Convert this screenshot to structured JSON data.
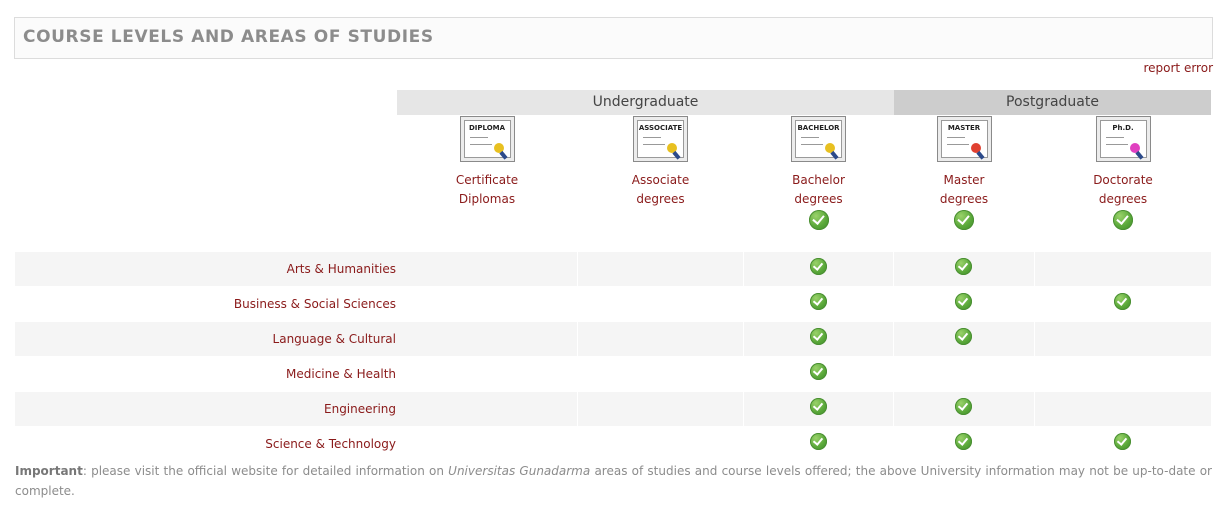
{
  "header": {
    "title": "COURSE LEVELS AND AREAS OF STUDIES"
  },
  "report_error": "report error",
  "groups": {
    "undergraduate": "Undergraduate",
    "postgraduate": "Postgraduate"
  },
  "levels": [
    {
      "cert_label": "DIPLOMA",
      "name_line1": "Certificate",
      "name_line2": "Diplomas",
      "offered": false,
      "seal_color": "#e8c020"
    },
    {
      "cert_label": "ASSOCIATE",
      "name_line1": "Associate",
      "name_line2": "degrees",
      "offered": false,
      "seal_color": "#e8c020"
    },
    {
      "cert_label": "BACHELOR",
      "name_line1": "Bachelor",
      "name_line2": "degrees",
      "offered": true,
      "seal_color": "#e8c020"
    },
    {
      "cert_label": "MASTER",
      "name_line1": "Master",
      "name_line2": "degrees",
      "offered": true,
      "seal_color": "#e04030"
    },
    {
      "cert_label": "Ph.D.",
      "name_line1": "Doctorate",
      "name_line2": "degrees",
      "offered": true,
      "seal_color": "#e040c0"
    }
  ],
  "areas": [
    {
      "name": "Arts & Humanities",
      "checks": [
        false,
        false,
        true,
        true,
        false
      ]
    },
    {
      "name": "Business & Social Sciences",
      "checks": [
        false,
        false,
        true,
        true,
        true
      ]
    },
    {
      "name": "Language & Cultural",
      "checks": [
        false,
        false,
        true,
        true,
        false
      ]
    },
    {
      "name": "Medicine & Health",
      "checks": [
        false,
        false,
        true,
        false,
        false
      ]
    },
    {
      "name": "Engineering",
      "checks": [
        false,
        false,
        true,
        true,
        false
      ]
    },
    {
      "name": "Science & Technology",
      "checks": [
        false,
        false,
        true,
        true,
        true
      ]
    }
  ],
  "note": {
    "bold": "Important",
    "text1": ": please visit the official website for detailed information on ",
    "italic": "Universitas Gunadarma",
    "text2": " areas of studies and course levels offered; the above University information may not be up-to-date or complete."
  },
  "icons": {
    "check": "check-icon",
    "certificate": "certificate-icon"
  }
}
